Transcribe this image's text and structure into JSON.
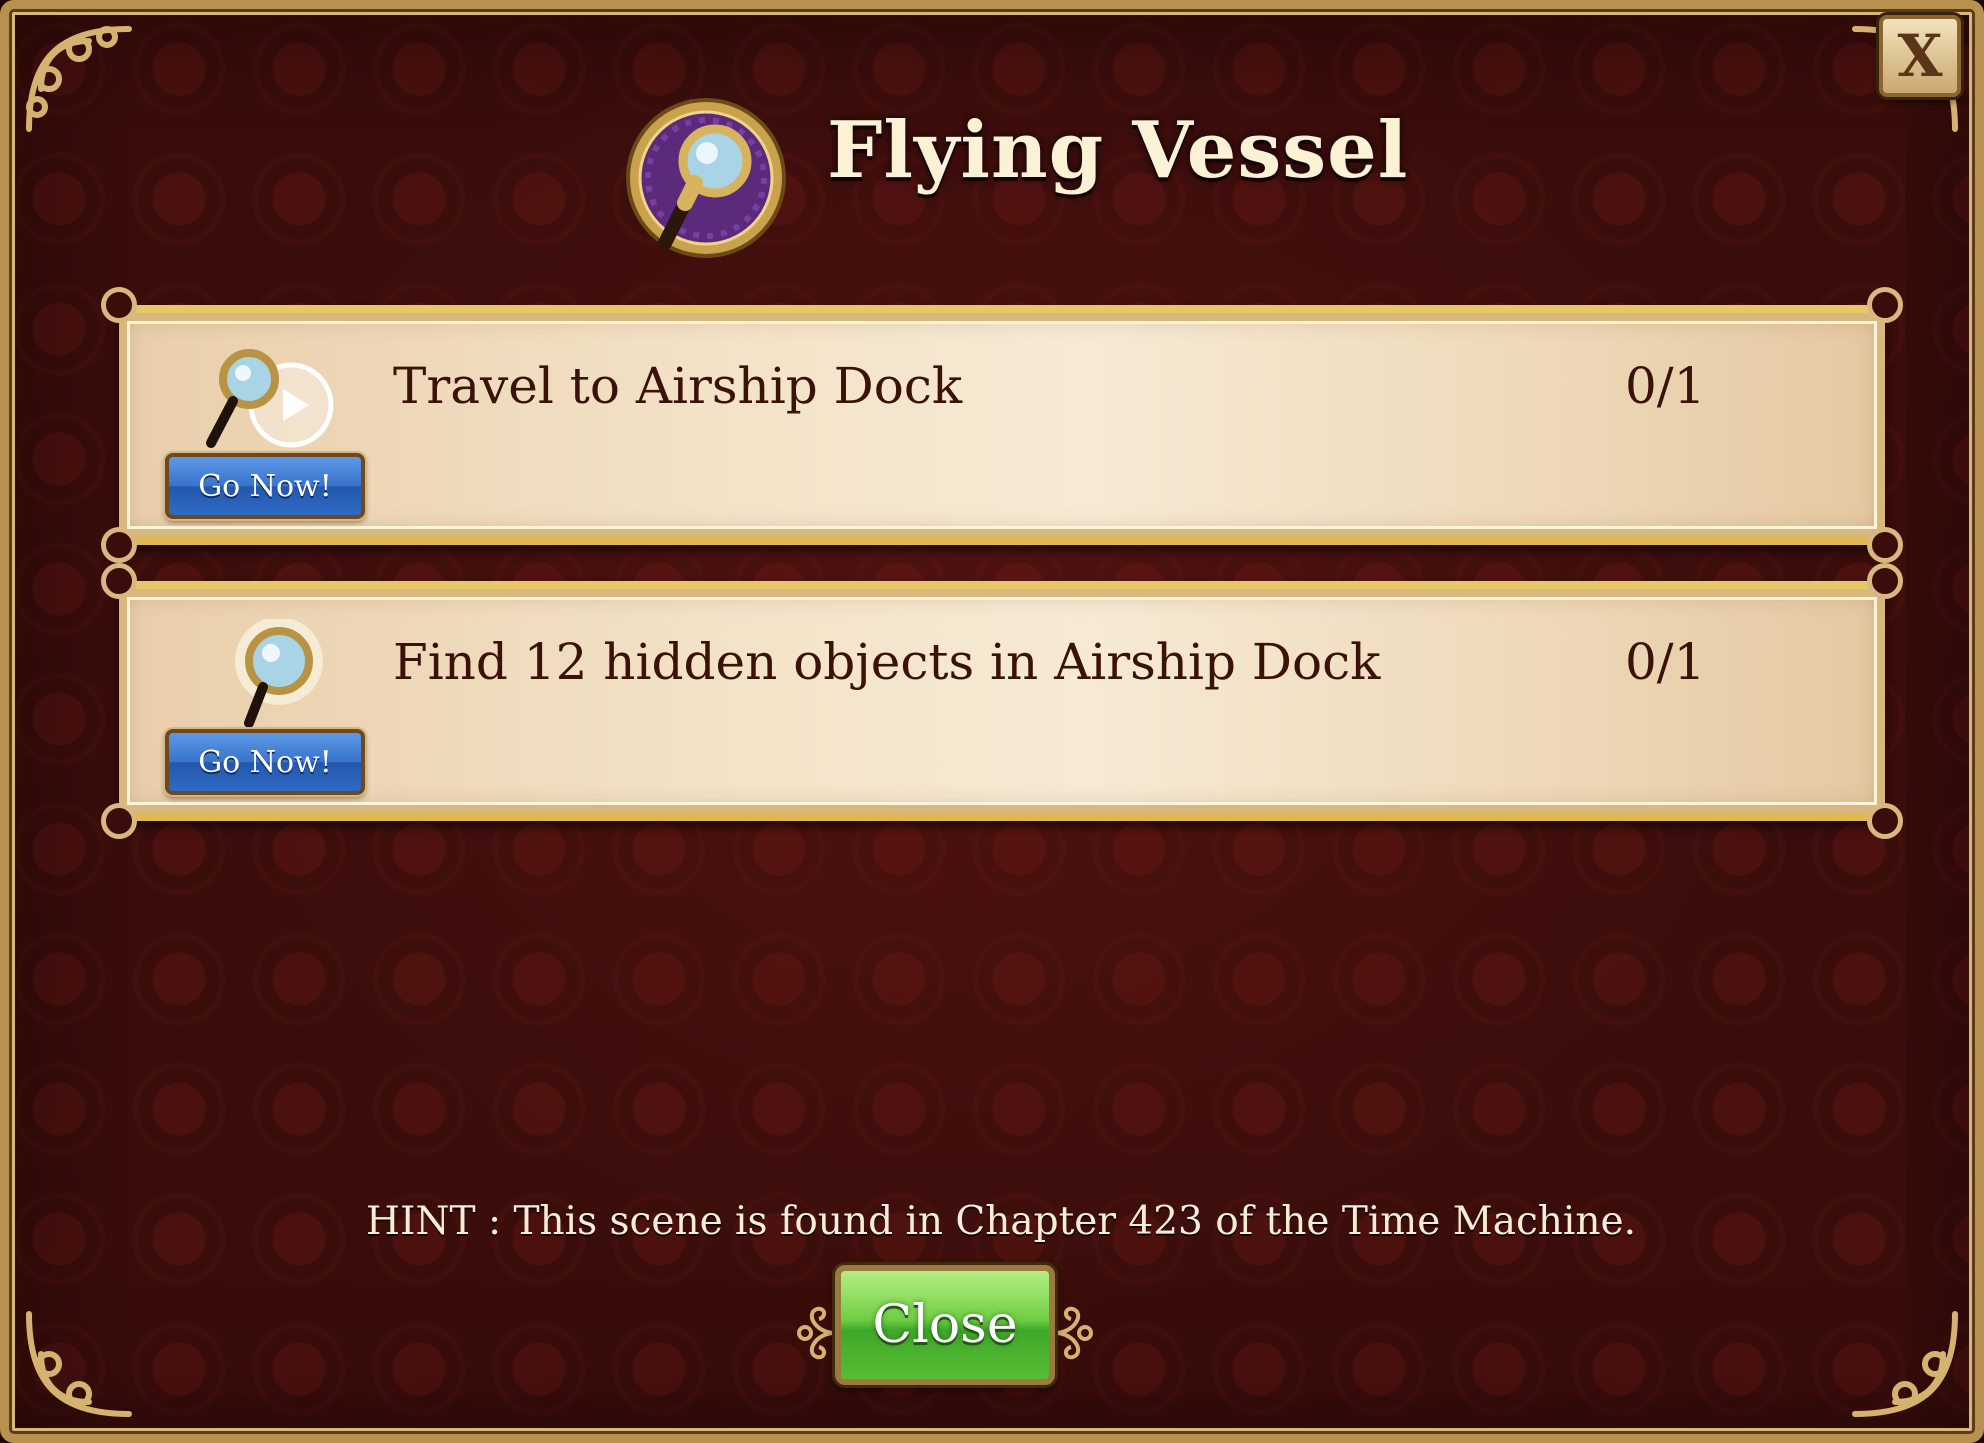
{
  "dialog": {
    "title": "Flying Vessel",
    "header_icon": "magnifying-glass-icon",
    "close_x_label": "X"
  },
  "tasks": [
    {
      "label": "Travel to Airship Dock",
      "progress": "0/1",
      "icon": "magnifier-play-icon",
      "button_label": "Go Now!"
    },
    {
      "label": "Find 12 hidden objects in Airship Dock",
      "progress": "0/1",
      "icon": "magnifier-sparkle-icon",
      "button_label": "Go Now!"
    }
  ],
  "hint": "HINT : This scene is found in Chapter 423 of the Time Machine.",
  "close_button_label": "Close",
  "colors": {
    "background": "#3a0d0b",
    "panel": "#f3e3c8",
    "go_button": "#3a73cc",
    "close_button": "#5bbf36",
    "gold_trim": "#d8b87f"
  }
}
